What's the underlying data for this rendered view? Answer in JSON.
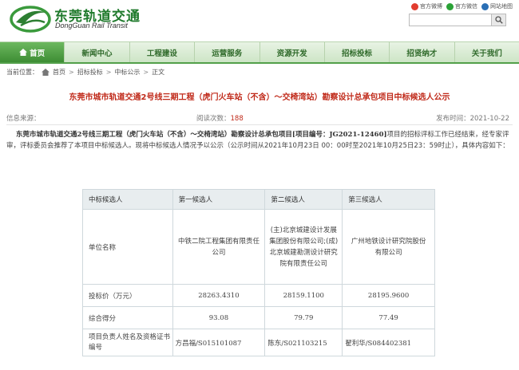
{
  "header": {
    "brand_cn": "东莞轨道交通",
    "brand_en": "DongGuan Rail Transit",
    "links": [
      {
        "label": "官方微博",
        "icon": "weibo-icon"
      },
      {
        "label": "官方微信",
        "icon": "wechat-icon"
      },
      {
        "label": "网站地图",
        "icon": "globe-icon"
      }
    ],
    "search": {
      "value": "",
      "placeholder": ""
    }
  },
  "nav": {
    "items": [
      "首页",
      "新闻中心",
      "工程建设",
      "运营服务",
      "资源开发",
      "招标投标",
      "招贤纳才",
      "关于我们"
    ]
  },
  "breadcrumb": {
    "label": "当前位置：",
    "items": [
      "首页",
      "招标投标",
      "中标公示",
      "正文"
    ]
  },
  "article": {
    "title": "东莞市城市轨道交通2号线三期工程（虎门火车站（不含）～交椅湾站）勘察设计总承包项目中标候选人公示",
    "source_label": "信息来源：",
    "views_label": "阅读次数：",
    "views": "188",
    "date_label": "发布时间：",
    "date": "2021-10-22",
    "body_highlight": "东莞市城市轨道交通2号线三期工程（虎门火车站（不含）～交椅湾站）勘察设计总承包项目[项目编号：JG2021-12460]",
    "body_rest": "项目的招标评标工作已经结束，经专家评审，评标委员会推荐了本项目中标候选人。现将中标候选人情况予以公示（公示时间从2021年10月23日 00：00时至2021年10月25日23：59时止），具体内容如下："
  },
  "table": {
    "headers": [
      "中标候选人",
      "第一候选人",
      "第二候选人",
      "第三候选人"
    ],
    "rows": {
      "unit": {
        "label": "单位名称",
        "values": [
          [
            "中铁二院工程集团有限责任",
            "公司"
          ],
          [
            "(主)北京城建设计发展",
            "集团股份有限公司;(成)",
            "北京城建勘测设计研究",
            "院有限责任公司"
          ],
          [
            "广州地铁设计研究院股份",
            "有限公司"
          ]
        ]
      },
      "bid": {
        "label": "投标价（万元）",
        "values": [
          "28263.4310",
          "28159.1100",
          "28195.9600"
        ]
      },
      "score": {
        "label": "综合得分",
        "values": [
          "93.08",
          "79.79",
          "77.49"
        ]
      },
      "pm": {
        "label": "项目负责人姓名及资格证书编号",
        "values": [
          "方昌福/S015101087",
          "陈东/S021103215",
          "翟利华/S084402381"
        ]
      }
    }
  },
  "colors": {
    "brand_green": "#1f7a2c",
    "nav_active": "#3d8d34",
    "title_red": "#c02a1a"
  }
}
